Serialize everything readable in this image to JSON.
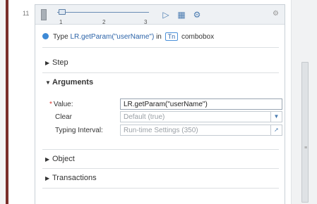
{
  "step": {
    "number": "11"
  },
  "toolbar": {
    "slider_ticks": [
      "1",
      "2",
      "3"
    ],
    "icons": [
      "step-play-icon",
      "step-screenshot-icon",
      "step-settings-icon"
    ],
    "right_icon": "gear-icon"
  },
  "header": {
    "prefix": "Type",
    "param": "LR.getParam(\"userName\")",
    "in_word": "in",
    "badge": "Tn",
    "target": "combobox"
  },
  "sections": {
    "step": "Step",
    "arguments": "Arguments",
    "object": "Object",
    "transactions": "Transactions"
  },
  "arguments": {
    "value_label": "Value:",
    "value": "LR.getParam(\"userName\")",
    "clear_label": "Clear",
    "clear_value": "Default (true)",
    "typing_label": "Typing Interval:",
    "typing_value": "Run-time Settings (350)"
  }
}
